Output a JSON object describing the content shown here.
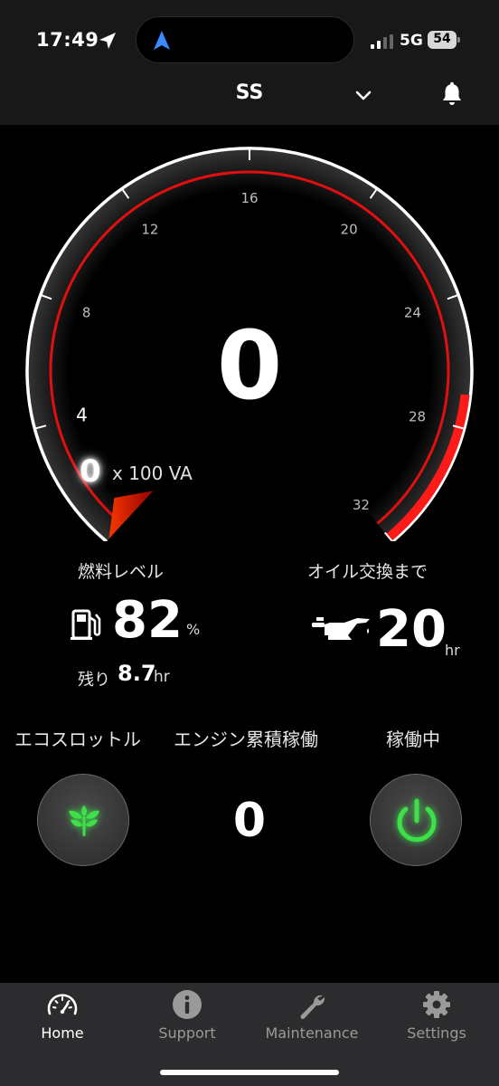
{
  "status_bar": {
    "time": "17:49",
    "network": "5G",
    "battery": "54"
  },
  "header": {
    "title": "SS"
  },
  "gauge": {
    "value": "0",
    "needle_value": "0",
    "unit": "x 100 VA",
    "min": 0,
    "max": 32,
    "reading": 0,
    "tick_labels": [
      "4",
      "8",
      "12",
      "16",
      "20",
      "24",
      "28",
      "32"
    ],
    "colors": {
      "arc": "#e01010",
      "outline": "#ffffff",
      "redzone": "#ff1a1a"
    }
  },
  "fuel": {
    "label": "燃料レベル",
    "value": "82",
    "unit": "%",
    "remaining_label": "残り",
    "remaining_value": "8.7",
    "remaining_unit": "hr"
  },
  "oil": {
    "label": "オイル交換まで",
    "value": "20",
    "unit": "hr"
  },
  "controls": {
    "eco_label": "エコスロットル",
    "engine_label": "エンジン累積稼働",
    "engine_value": "0",
    "running_label": "稼働中",
    "accent_color": "#3ee04a"
  },
  "tabs": [
    {
      "label": "Home",
      "icon": "speedometer-icon",
      "active": true
    },
    {
      "label": "Support",
      "icon": "info-icon",
      "active": false
    },
    {
      "label": "Maintenance",
      "icon": "wrench-icon",
      "active": false
    },
    {
      "label": "Settings",
      "icon": "gear-icon",
      "active": false
    }
  ]
}
